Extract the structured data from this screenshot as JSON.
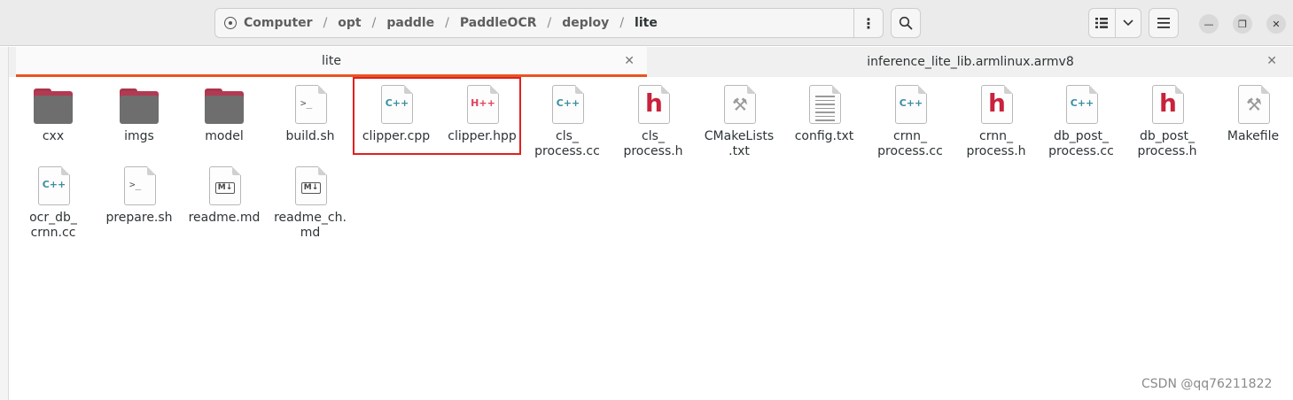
{
  "pathbar": {
    "crumbs": [
      "Computer",
      "opt",
      "paddle",
      "PaddleOCR",
      "deploy",
      "lite"
    ],
    "separator": "/"
  },
  "tabs": [
    {
      "label": "lite",
      "active": true
    },
    {
      "label": "inference_lite_lib.armlinux.armv8",
      "active": false
    }
  ],
  "files": [
    {
      "name": "cxx",
      "type": "folder"
    },
    {
      "name": "imgs",
      "type": "folder"
    },
    {
      "name": "model",
      "type": "folder"
    },
    {
      "name": "build.sh",
      "type": "shell"
    },
    {
      "name": "clipper.cpp",
      "type": "cpp"
    },
    {
      "name": "clipper.hpp",
      "type": "hpp"
    },
    {
      "name": "cls_\nprocess.cc",
      "type": "cpp"
    },
    {
      "name": "cls_\nprocess.h",
      "type": "header"
    },
    {
      "name": "CMakeLists\n.txt",
      "type": "cmake"
    },
    {
      "name": "config.txt",
      "type": "text"
    },
    {
      "name": "crnn_\nprocess.cc",
      "type": "cpp"
    },
    {
      "name": "crnn_\nprocess.h",
      "type": "header"
    },
    {
      "name": "db_post_\nprocess.cc",
      "type": "cpp"
    },
    {
      "name": "db_post_\nprocess.h",
      "type": "header"
    },
    {
      "name": "Makefile",
      "type": "cmake"
    },
    {
      "name": "ocr_db_\ncrnn.cc",
      "type": "cpp"
    },
    {
      "name": "prepare.sh",
      "type": "shell"
    },
    {
      "name": "readme.md",
      "type": "markdown"
    },
    {
      "name": "readme_ch.\nmd",
      "type": "markdown"
    }
  ],
  "icon_glyphs": {
    "cpp": "C++",
    "hpp": "H++",
    "header": "h",
    "shell": ">_",
    "markdown": "M↓"
  },
  "colors": {
    "accent": "#e95420",
    "highlight_box": "#e02020",
    "folder": "#6e6e6e",
    "folder_back": "#b23a52"
  },
  "watermark": "CSDN @qq76211822"
}
